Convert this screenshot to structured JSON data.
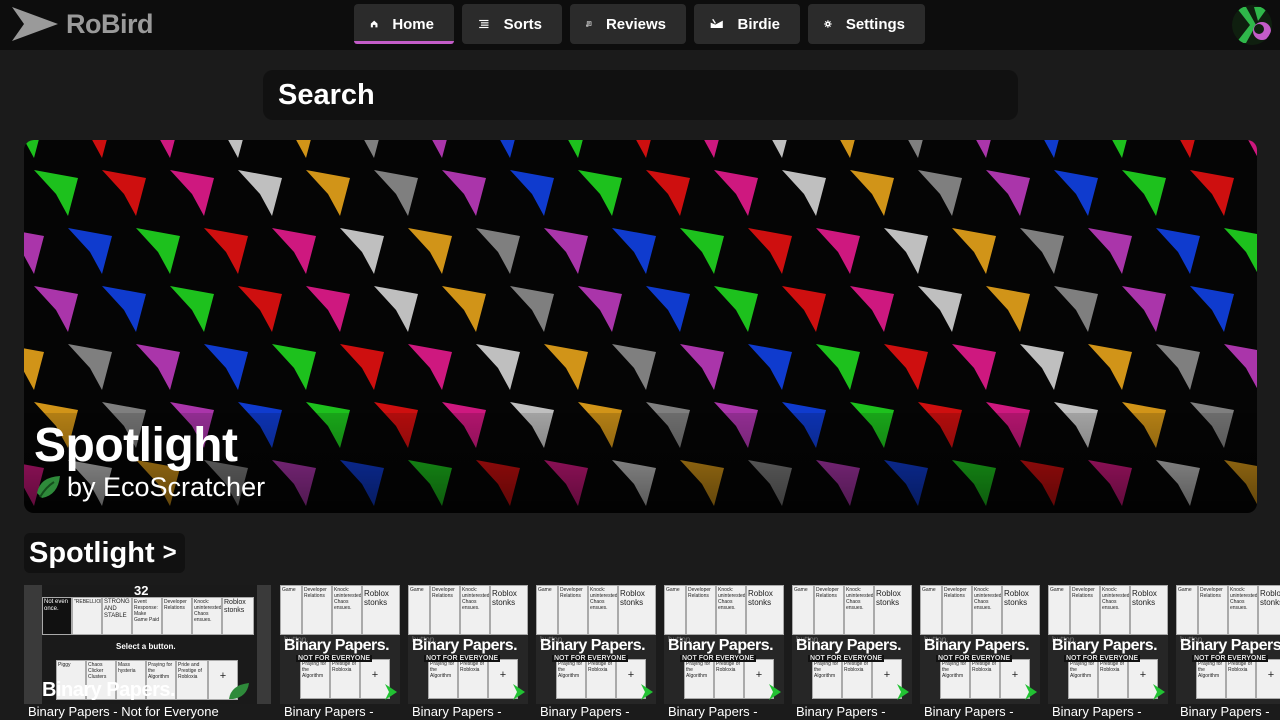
{
  "app": {
    "name": "RoBird"
  },
  "nav": {
    "home": "Home",
    "sorts": "Sorts",
    "reviews": "Reviews",
    "birdie": "Birdie",
    "settings": "Settings"
  },
  "search": {
    "placeholder": "Search"
  },
  "banner": {
    "title": "Spotlight",
    "byline": "by EcoScratcher"
  },
  "section": {
    "title": "Spotlight",
    "chevron": ">"
  },
  "cards": [
    {
      "title": "Binary Papers - Not for Everyone"
    },
    {
      "title": "Binary Papers -"
    },
    {
      "title": "Binary Papers -"
    },
    {
      "title": "Binary Papers -"
    },
    {
      "title": "Binary Papers -"
    },
    {
      "title": "Binary Papers -"
    },
    {
      "title": "Binary Papers -"
    },
    {
      "title": "Binary Papers -"
    },
    {
      "title": "Binary Papers -"
    }
  ],
  "thumb": {
    "counter": "32",
    "select_prompt": "Select a button.",
    "logo": "Binary Papers.",
    "tagline": "NOT FOR EVERYONE",
    "cells_top": [
      "Not even once.",
      "\"REBELLION\"",
      "STRONG AND STABLE",
      "Event Response: Make Game Paid",
      "Developer Relations",
      "Knock: uninterested. Chaos ensues.",
      "Roblox stonks"
    ],
    "cells_bottom": [
      "Piggy",
      "Chaos Clicker Clusters",
      "Mass hysteria",
      "Praying for the Algorithm",
      "Pride and Prestige of Robloxia",
      "+"
    ],
    "small_top": [
      "Game",
      "Developer Relations",
      "Knock: uninterested. Chaos ensues.",
      "Roblox stonks"
    ],
    "small_bottom": [
      "button.",
      "Praying for the Algorithm",
      "Prestige of Robloxia",
      "+"
    ]
  },
  "colors": {
    "accent": "#c35cc8",
    "topbar": "#0d0d0d",
    "background": "#1b1b1b",
    "panel": "#2b2b2b"
  }
}
